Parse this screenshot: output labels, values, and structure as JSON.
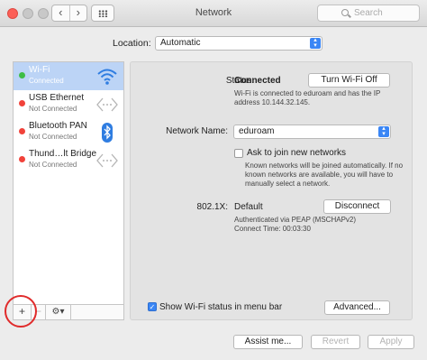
{
  "window": {
    "title": "Network"
  },
  "toolbar": {
    "back_glyph": "‹",
    "forward_glyph": "›",
    "search_placeholder": "Search"
  },
  "location": {
    "label": "Location:",
    "value": "Automatic"
  },
  "sidebar": {
    "items": [
      {
        "name": "Wi-Fi",
        "status": "Connected",
        "status_color": "#3dbd45",
        "icon": "wifi-icon",
        "selected": true
      },
      {
        "name": "USB Ethernet",
        "status": "Not Connected",
        "status_color": "#f1423a",
        "icon": "ethernet-icon"
      },
      {
        "name": "Bluetooth PAN",
        "status": "Not Connected",
        "status_color": "#f1423a",
        "icon": "bluetooth-icon"
      },
      {
        "name": "Thund…lt Bridge",
        "status": "Not Connected",
        "status_color": "#f1423a",
        "icon": "thunderbolt-bridge-icon"
      }
    ],
    "footer": {
      "add": "+",
      "remove": "−",
      "gear": "⚙▾"
    }
  },
  "detail": {
    "status_label": "Status:",
    "status_value": "Connected",
    "turn_off_button": "Turn Wi-Fi Off",
    "status_desc": "Wi-Fi is connected to eduroam and has the IP address 10.144.32.145.",
    "network_name_label": "Network Name:",
    "network_name_value": "eduroam",
    "ask_to_join_label": "Ask to join new networks",
    "ask_to_join_desc": "Known networks will be joined automatically. If no known networks are available, you will have to manually select a network.",
    "dot1x_label": "802.1X:",
    "dot1x_value": "Default",
    "disconnect_button": "Disconnect",
    "dot1x_desc_1": "Authenticated via PEAP (MSCHAPv2)",
    "dot1x_desc_2": "Connect Time: 00:03:30",
    "show_status_label": "Show Wi-Fi status in menu bar",
    "advanced_button": "Advanced..."
  },
  "footer": {
    "assist": "Assist me...",
    "revert": "Revert",
    "apply": "Apply"
  },
  "colors": {
    "accent": "#3a86f5",
    "selection": "#bcd4f6",
    "highlight_circle": "#e02b2b"
  }
}
